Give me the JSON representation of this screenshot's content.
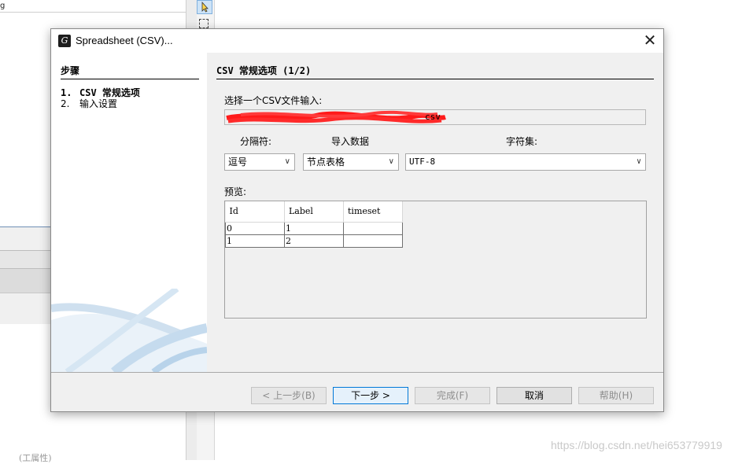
{
  "background_app": {
    "top_text": "g",
    "bottom_text": "(工属性)",
    "watermark": "https://blog.csdn.net/hei653779919"
  },
  "dialog": {
    "title": "Spreadsheet (CSV)...",
    "close_symbol": "✕"
  },
  "steps": {
    "title": "步骤",
    "items": [
      {
        "num": "1.",
        "label": "CSV 常规选项",
        "active": true
      },
      {
        "num": "2.",
        "label": "输入设置",
        "active": false
      }
    ]
  },
  "main": {
    "section_title": "CSV 常规选项 (1/2)",
    "file_label": "选择一个CSV文件输入:",
    "file_value_visible": "csv",
    "separator_label": "分隔符:",
    "separator_value": "逗号",
    "import_label": "导入数据",
    "import_value": "节点表格",
    "charset_label": "字符集:",
    "charset_value": "UTF-8",
    "preview_label": "预览:",
    "preview_table": {
      "columns": [
        "Id",
        "Label",
        "timeset"
      ],
      "rows": [
        [
          "0",
          "1",
          ""
        ],
        [
          "1",
          "2",
          ""
        ]
      ]
    }
  },
  "buttons": {
    "prev": "< 上一步(B)",
    "next": "下一步 >",
    "finish": "完成(F)",
    "cancel": "取消",
    "help": "帮助(H)"
  }
}
